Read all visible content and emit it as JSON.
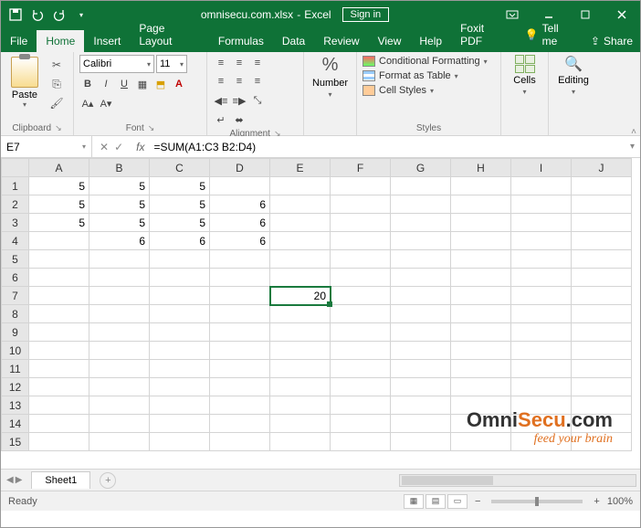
{
  "titlebar": {
    "filename": "omnisecu.com.xlsx",
    "app": "Excel",
    "signin": "Sign in"
  },
  "tabs": {
    "file": "File",
    "home": "Home",
    "insert": "Insert",
    "pagelayout": "Page Layout",
    "formulas": "Formulas",
    "data": "Data",
    "review": "Review",
    "view": "View",
    "help": "Help",
    "foxit": "Foxit PDF",
    "tellme": "Tell me",
    "share": "Share"
  },
  "ribbon": {
    "paste": "Paste",
    "clipboard": "Clipboard",
    "font_name": "Calibri",
    "font_size": "11",
    "font": "Font",
    "alignment": "Alignment",
    "number": "Number",
    "cond_fmt": "Conditional Formatting",
    "fmt_table": "Format as Table",
    "cell_styles": "Cell Styles",
    "styles": "Styles",
    "cells": "Cells",
    "editing": "Editing"
  },
  "namebox": "E7",
  "formula": "=SUM(A1:C3 B2:D4)",
  "columns": [
    "A",
    "B",
    "C",
    "D",
    "E",
    "F",
    "G",
    "H",
    "I",
    "J"
  ],
  "rows": [
    "1",
    "2",
    "3",
    "4",
    "5",
    "6",
    "7",
    "8",
    "9",
    "10",
    "11",
    "12",
    "13",
    "14",
    "15"
  ],
  "cells": {
    "A1": "5",
    "B1": "5",
    "C1": "5",
    "A2": "5",
    "B2": "5",
    "C2": "5",
    "D2": "6",
    "A3": "5",
    "B3": "5",
    "C3": "5",
    "D3": "6",
    "B4": "6",
    "C4": "6",
    "D4": "6",
    "E7": "20"
  },
  "selected": "E7",
  "sheet_tab": "Sheet1",
  "status": "Ready",
  "zoom": "100%",
  "watermark": {
    "brand1": "Omni",
    "brand2": "Secu",
    "brand3": ".com",
    "tag": "feed your brain"
  }
}
